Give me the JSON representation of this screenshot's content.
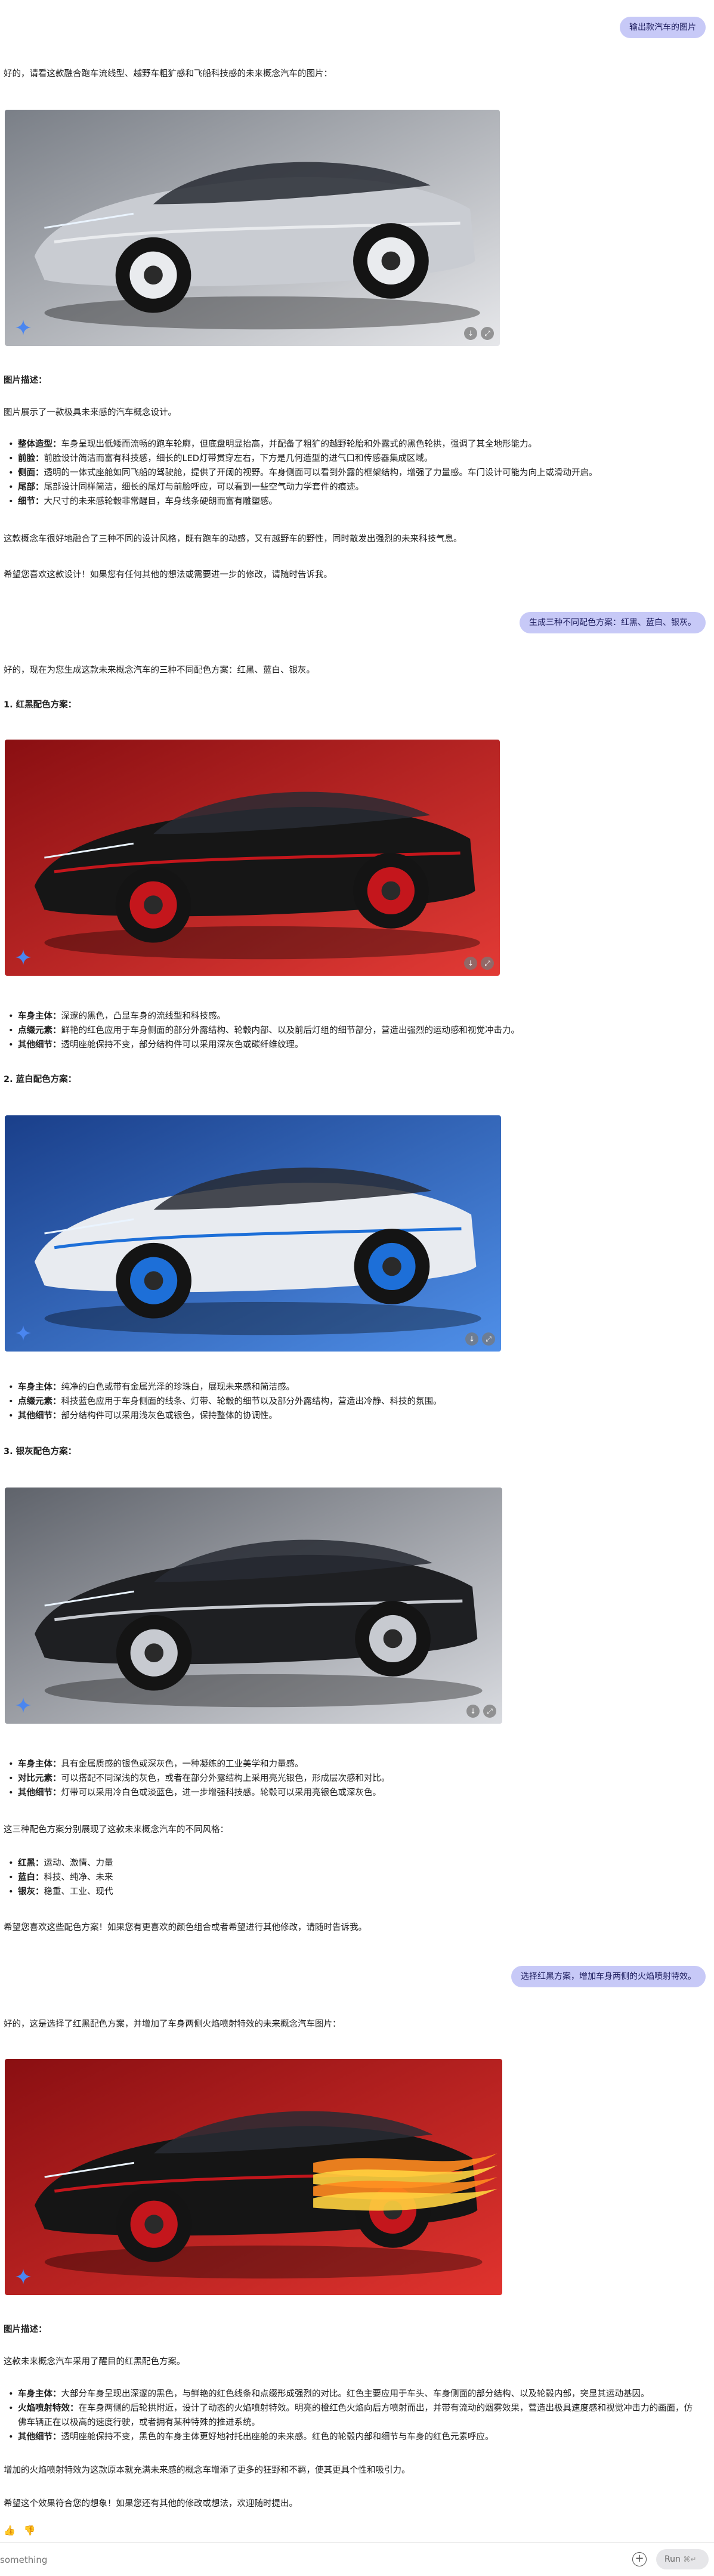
{
  "messages": {
    "user1": "输出款汽车的图片",
    "reply1_intro": "好的，请看这款融合跑车流线型、越野车粗犷感和飞船科技感的未来概念汽车的图片：",
    "reply1_desc_title": "图片描述：",
    "reply1_desc_intro": "图片展示了一款极具未来感的汽车概念设计。",
    "reply1_bullets": [
      {
        "label": "整体造型：",
        "text": "车身呈现出低矮而流畅的跑车轮廓，但底盘明显抬高，并配备了粗犷的越野轮胎和外露式的黑色轮拱，强调了其全地形能力。"
      },
      {
        "label": "前脸：",
        "text": "前脸设计简洁而富有科技感，细长的LED灯带贯穿左右，下方是几何造型的进气口和传感器集成区域。"
      },
      {
        "label": "侧面：",
        "text": "透明的一体式座舱如同飞船的驾驶舱，提供了开阔的视野。车身侧面可以看到外露的框架结构，增强了力量感。车门设计可能为向上或滑动开启。"
      },
      {
        "label": "尾部：",
        "text": "尾部设计同样简洁，细长的尾灯与前脸呼应，可以看到一些空气动力学套件的痕迹。"
      },
      {
        "label": "细节：",
        "text": "大尺寸的未来感轮毂非常醒目，车身线条硬朗而富有雕塑感。"
      }
    ],
    "reply1_summary": "这款概念车很好地融合了三种不同的设计风格，既有跑车的动感，又有越野车的野性，同时散发出强烈的未来科技气息。",
    "reply1_closing": "希望您喜欢这款设计！如果您有任何其他的想法或需要进一步的修改，请随时告诉我。",
    "user2": "生成三种不同配色方案：红黑、蓝白、银灰。",
    "reply2_intro": "好的，现在为您生成这款未来概念汽车的三种不同配色方案：红黑、蓝白、银灰。",
    "scheme_red_title": "1. 红黑配色方案：",
    "scheme_red_bullets": [
      {
        "label": "车身主体：",
        "text": "深邃的黑色，凸显车身的流线型和科技感。"
      },
      {
        "label": "点缀元素：",
        "text": "鲜艳的红色应用于车身侧面的部分外露结构、轮毂内部、以及前后灯组的细节部分，营造出强烈的运动感和视觉冲击力。"
      },
      {
        "label": "其他细节：",
        "text": "透明座舱保持不变，部分结构件可以采用深灰色或碳纤维纹理。"
      }
    ],
    "scheme_blue_title": "2. 蓝白配色方案：",
    "scheme_blue_bullets": [
      {
        "label": "车身主体：",
        "text": "纯净的白色或带有金属光泽的珍珠白，展现未来感和简洁感。"
      },
      {
        "label": "点缀元素：",
        "text": "科技蓝色应用于车身侧面的线条、灯带、轮毂的细节以及部分外露结构，营造出冷静、科技的氛围。"
      },
      {
        "label": "其他细节：",
        "text": "部分结构件可以采用浅灰色或银色，保持整体的协调性。"
      }
    ],
    "scheme_silver_title": "3. 银灰配色方案：",
    "scheme_silver_bullets": [
      {
        "label": "车身主体：",
        "text": "具有金属质感的银色或深灰色，一种凝练的工业美学和力量感。"
      },
      {
        "label": "对比元素：",
        "text": "可以搭配不同深浅的灰色，或者在部分外露结构上采用亮光银色，形成层次感和对比。"
      },
      {
        "label": "其他细节：",
        "text": "灯带可以采用冷白色或淡蓝色，进一步增强科技感。轮毂可以采用亮银色或深灰色。"
      }
    ],
    "reply2_summary": "这三种配色方案分别展现了这款未来概念汽车的不同风格：",
    "reply2_styles": [
      {
        "label": "红黑：",
        "text": "运动、激情、力量"
      },
      {
        "label": "蓝白：",
        "text": "科技、纯净、未来"
      },
      {
        "label": "银灰：",
        "text": "稳重、工业、现代"
      }
    ],
    "reply2_closing": "希望您喜欢这些配色方案！如果您有更喜欢的颜色组合或者希望进行其他修改，请随时告诉我。",
    "user3": "选择红黑方案，增加车身两侧的火焰喷射特效。",
    "reply3_intro": "好的，这是选择了红黑配色方案，并增加了车身两侧火焰喷射特效的未来概念汽车图片：",
    "reply3_desc_title": "图片描述：",
    "reply3_desc_intro": "这款未来概念汽车采用了醒目的红黑配色方案。",
    "reply3_bullets": [
      {
        "label": "车身主体：",
        "text": "大部分车身呈现出深邃的黑色，与鲜艳的红色线条和点缀形成强烈的对比。红色主要应用于车头、车身侧面的部分结构、以及轮毂内部，突显其运动基因。"
      },
      {
        "label": "火焰喷射特效：",
        "text": "在车身两侧的后轮拱附近，设计了动态的火焰喷射特效。明亮的橙红色火焰向后方喷射而出，并带有流动的烟雾效果，营造出极具速度感和视觉冲击力的画面，仿佛车辆正在以极高的速度行驶，或者拥有某种特殊的推进系统。"
      },
      {
        "label": "其他细节：",
        "text": "透明座舱保持不变，黑色的车身主体更好地衬托出座舱的未来感。红色的轮毂内部和细节与车身的红色元素呼应。"
      }
    ],
    "reply3_summary": "增加的火焰喷射特效为这款原本就充满未来感的概念车增添了更多的狂野和不羁，使其更具个性和吸引力。",
    "reply3_closing": "希望这个效果符合您的想象！如果您还有其他的修改或想法，欢迎随时提出。"
  },
  "images": {
    "silver": {
      "body": "#c9ccd2",
      "accent": "#e9ebee",
      "bg1": "#7a7f87",
      "bg2": "#e6e7ea"
    },
    "red": {
      "body": "#161616",
      "accent": "#c4161c",
      "bg1": "#8a0f12",
      "bg2": "#e23a35"
    },
    "blue": {
      "body": "#e8ebf0",
      "accent": "#1d6fd8",
      "bg1": "#1a3f8a",
      "bg2": "#4f8fe8"
    },
    "graphite": {
      "body": "#1e1f22",
      "accent": "#c7cad0",
      "bg1": "#5f636b",
      "bg2": "#d9dbe0"
    },
    "flame": {
      "body": "#151515",
      "accent": "#c4161c",
      "bg1": "#8a0f12",
      "bg2": "#e0332e",
      "fire": "#ff8a1f"
    }
  },
  "image_icons": {
    "download": "download-icon",
    "expand": "expand-icon",
    "gemini": "gemini-sparkle-icon"
  },
  "bottom": {
    "placeholder": "something",
    "run_label": "Run"
  }
}
